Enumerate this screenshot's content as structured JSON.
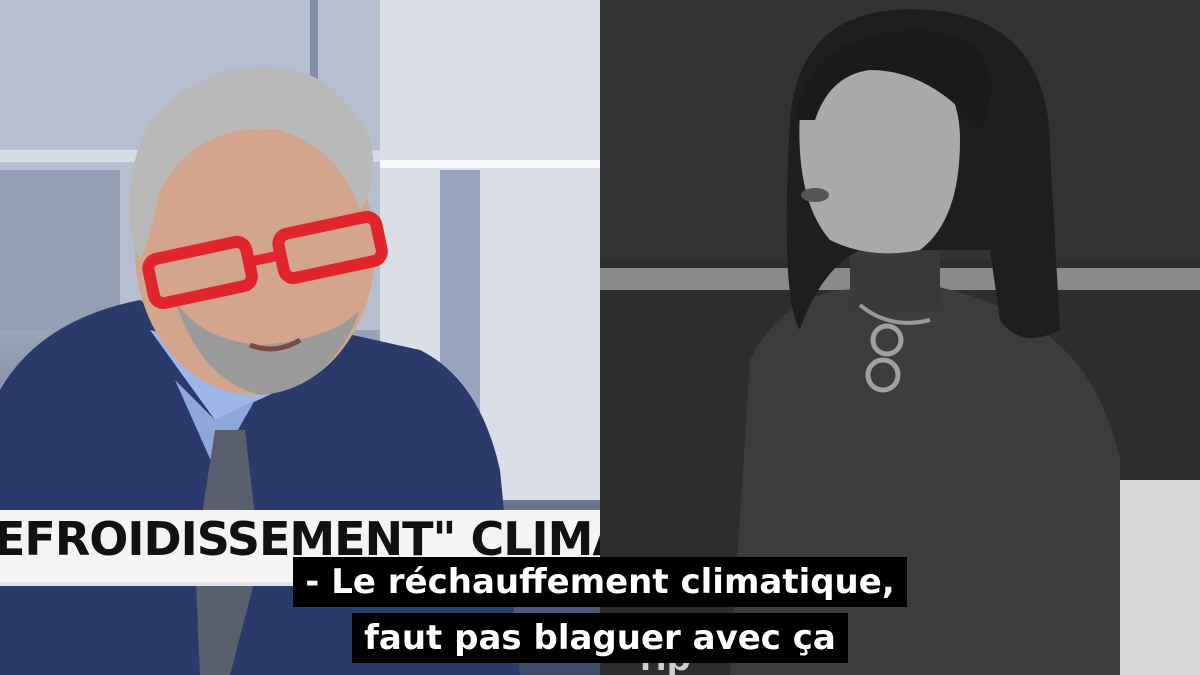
{
  "video": {
    "left_panel": {
      "lower_third_text": "EFROIDISSEMENT\" CLIMAT"
    },
    "right_panel": {
      "background_text": "rip"
    },
    "subtitle": {
      "line1": "- Le réchauffement climatique,",
      "line2": "faut pas blaguer avec ça"
    }
  },
  "colors": {
    "subtitle_bg": "#000000",
    "subtitle_text": "#ffffff",
    "lower_third_bg": "#f4f4f4",
    "glasses_red": "#e0262b",
    "suit_blue": "#2a3a6b"
  }
}
